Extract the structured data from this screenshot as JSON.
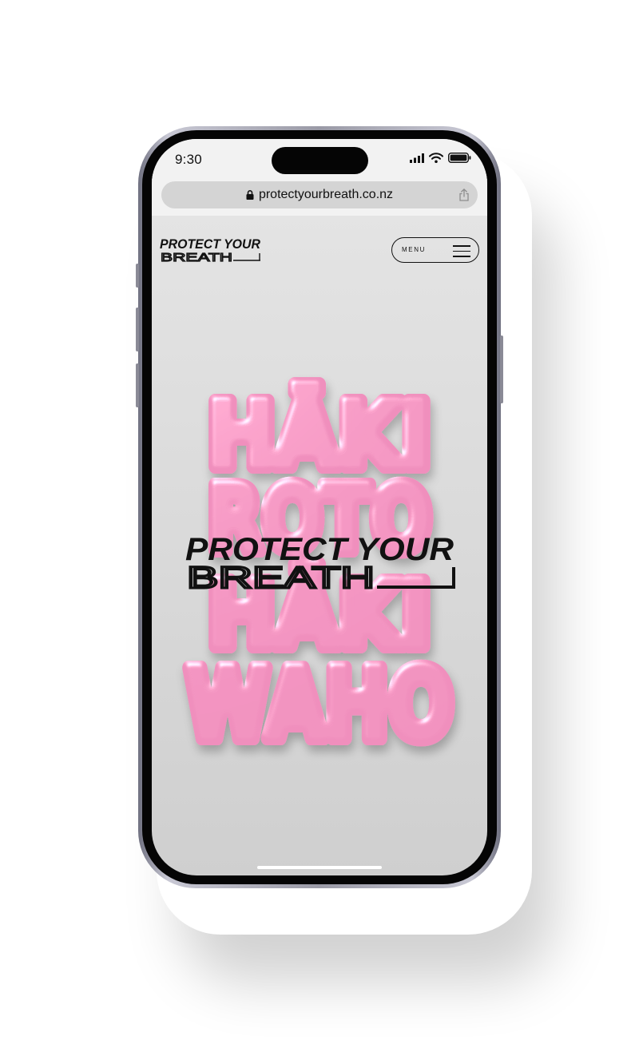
{
  "status_bar": {
    "time": "9:30"
  },
  "browser": {
    "url": "protectyourbreath.co.nz"
  },
  "site": {
    "logo": {
      "line1": "PROTECT YOUR",
      "line2": "BREATH"
    },
    "menu_label": "MENU",
    "hero": {
      "balloon_lines": [
        "HĀKI",
        "ROTO",
        "HĀKI",
        "WAHO"
      ],
      "overlay_line1": "PROTECT YOUR",
      "overlay_line2": "BREATH"
    }
  },
  "colors": {
    "balloon_pink": "#f08fbd",
    "screen_bg": "#dcdcdc",
    "ink": "#111111"
  },
  "icons": [
    "signal-icon",
    "wifi-icon",
    "battery-icon",
    "lock-icon",
    "share-icon",
    "hamburger-icon"
  ]
}
